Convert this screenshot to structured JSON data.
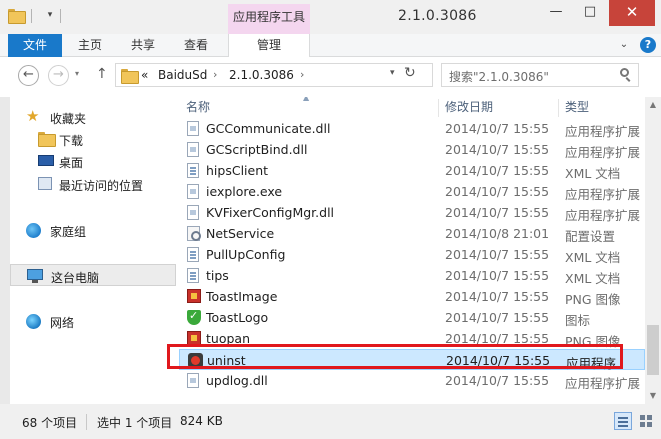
{
  "window": {
    "title": "2.1.0.3086",
    "context_tab_header": "应用程序工具",
    "controls": {
      "minimize": "—",
      "maximize": "□",
      "close": "✕"
    }
  },
  "ribbon": {
    "tabs": [
      "文件",
      "主页",
      "共享",
      "查看",
      "管理"
    ]
  },
  "address": {
    "prefix": "«",
    "segments": [
      "BaiduSd",
      "2.1.0.3086"
    ]
  },
  "search": {
    "placeholder": "搜索\"2.1.0.3086\""
  },
  "nav_pane": {
    "favorites": "收藏夹",
    "downloads": "下载",
    "desktop": "桌面",
    "recent": "最近访问的位置",
    "homegroup": "家庭组",
    "this_pc": "这台电脑",
    "network": "网络"
  },
  "columns": {
    "name": "名称",
    "date": "修改日期",
    "type": "类型"
  },
  "files": [
    {
      "name": "GCCommunicate.dll",
      "date": "2014/10/7 15:55",
      "type": "应用程序扩展",
      "icon": "dll-icon"
    },
    {
      "name": "GCScriptBind.dll",
      "date": "2014/10/7 15:55",
      "type": "应用程序扩展",
      "icon": "dll-icon"
    },
    {
      "name": "hipsClient",
      "date": "2014/10/7 15:55",
      "type": "XML 文档",
      "icon": "xml-icon"
    },
    {
      "name": "iexplore.exe",
      "date": "2014/10/7 15:55",
      "type": "应用程序扩展",
      "icon": "dll-icon"
    },
    {
      "name": "KVFixerConfigMgr.dll",
      "date": "2014/10/7 15:55",
      "type": "应用程序扩展",
      "icon": "dll-icon"
    },
    {
      "name": "NetService",
      "date": "2014/10/8 21:01",
      "type": "配置设置",
      "icon": "config-icon"
    },
    {
      "name": "PullUpConfig",
      "date": "2014/10/7 15:55",
      "type": "XML 文档",
      "icon": "xml-icon"
    },
    {
      "name": "tips",
      "date": "2014/10/7 15:55",
      "type": "XML 文档",
      "icon": "xml-icon"
    },
    {
      "name": "ToastImage",
      "date": "2014/10/7 15:55",
      "type": "PNG 图像",
      "icon": "png-icon"
    },
    {
      "name": "ToastLogo",
      "date": "2014/10/7 15:55",
      "type": "图标",
      "icon": "shield-icon"
    },
    {
      "name": "tuopan",
      "date": "2014/10/7 15:55",
      "type": "PNG 图像",
      "icon": "png-icon"
    },
    {
      "name": "uninst",
      "date": "2014/10/7 15:55",
      "type": "应用程序",
      "icon": "uninstaller-icon"
    },
    {
      "name": "updlog.dll",
      "date": "2014/10/7 15:55",
      "type": "应用程序扩展",
      "icon": "dll-icon"
    }
  ],
  "status": {
    "item_count": "68 个项目",
    "selected": "选中 1 个项目",
    "size": "824 KB"
  },
  "colors": {
    "accent": "#1979ca",
    "selection": "#cce8ff",
    "highlight_border": "#e0181d",
    "close_button": "#c7443a"
  }
}
